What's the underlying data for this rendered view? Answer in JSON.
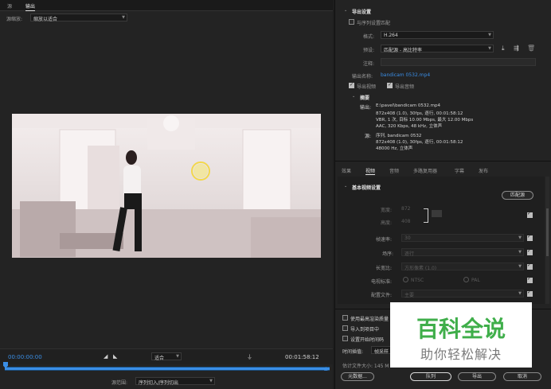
{
  "left": {
    "tabs": [
      {
        "label": "源"
      },
      {
        "label": "输出"
      }
    ],
    "scale_label": "源缩放:",
    "scale_value": "缩放以适合",
    "time_start": "00:00:00:00",
    "fit_value": "适合",
    "time_end": "00:01:58:12",
    "source_range_label": "源范围:",
    "source_range_value": "序列切入/序列切出"
  },
  "right": {
    "export_settings_title": "导出设置",
    "match_sequence_label": "与序列设置匹配",
    "format_label": "格式:",
    "format_value": "H.264",
    "preset_label": "预设:",
    "preset_value": "匹配源 - 高比特率",
    "comments_label": "注释:",
    "output_name_label": "输出名称:",
    "output_name_value": "bandicam 0532.mp4",
    "export_video_label": "导出视频",
    "export_audio_label": "导出音频",
    "summary_title": "摘要",
    "output_label": "输出:",
    "output_lines": [
      "E:\\pavel\\bandicam 0532.mp4",
      "872x408 (1.0), 30fps, 逐行, 00:01:58:12",
      "VBR, 1 次, 目标 10.00 Mbps, 最大 12.00 Mbps",
      "AAC, 320 Kbps, 48 kHz, 立体声"
    ],
    "source_label": "源:",
    "source_lines": [
      "序列, bandicam 0532",
      "872x408 (1.0), 30fps, 逐行, 00:01:58:12",
      "48000 Hz, 立体声"
    ],
    "tabs": [
      {
        "label": "效果"
      },
      {
        "label": "视频"
      },
      {
        "label": "音频"
      },
      {
        "label": "多路复用器"
      },
      {
        "label": "字幕"
      },
      {
        "label": "发布"
      }
    ],
    "basic_video_title": "基本视频设置",
    "match_source_button": "匹配源",
    "width_label": "宽度:",
    "width_value": "872",
    "height_label": "高度:",
    "height_value": "408",
    "frame_rate_label": "帧速率:",
    "frame_rate_value": "30",
    "field_order_label": "场序:",
    "field_order_value": "逐行",
    "aspect_label": "长宽比:",
    "aspect_value": "方形像素 (1.0)",
    "tv_standard_label": "电视标准:",
    "ntsc_label": "NTSC",
    "pal_label": "PAL",
    "profile_label": "配置文件:",
    "profile_value": "主要",
    "max_render_label": "使用最高渲染质量",
    "import_project_label": "导入到项目中",
    "set_timecode_label": "设置开始时间码",
    "time_interp_label": "时间插值:",
    "time_interp_value": "帧采样",
    "file_size_label": "估计文件大小: 145 M",
    "metadata_button": "元数据...",
    "queue_button": "队列",
    "export_button": "导出",
    "cancel_button": "取消"
  },
  "watermark": {
    "title": "百科全说",
    "subtitle": "助你轻松解决"
  },
  "colors": {
    "accent": "#3a8ee6",
    "watermark_green": "#3fae4a"
  }
}
